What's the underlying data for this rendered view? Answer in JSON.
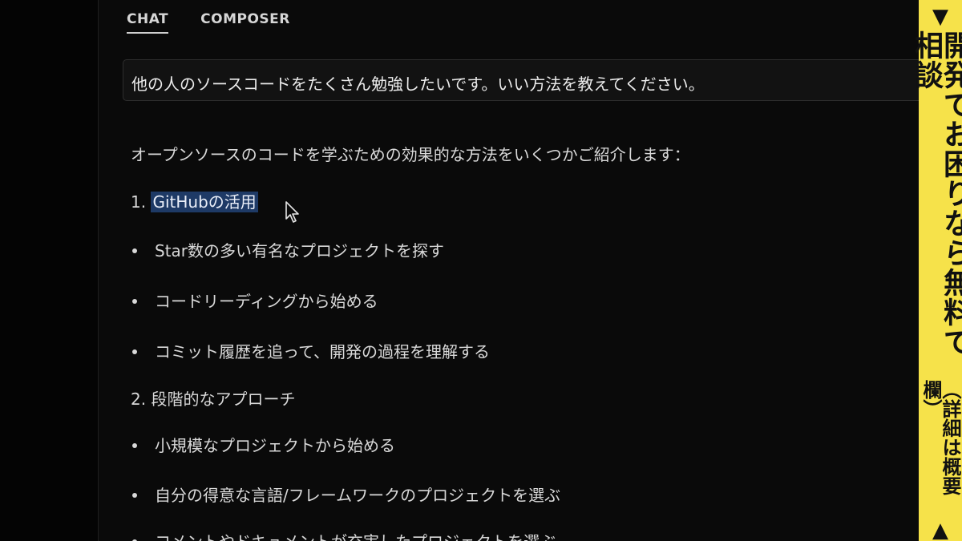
{
  "tabs": [
    {
      "label": "CHAT",
      "active": true
    },
    {
      "label": "COMPOSER",
      "active": false
    }
  ],
  "prompt": "他の人のソースコードをたくさん勉強したいです。いい方法を教えてください。",
  "response": {
    "intro": "オープンソースのコードを学ぶための効果的な方法をいくつかご紹介します：",
    "sections": [
      {
        "number": "1.",
        "title": "GitHubの活用",
        "items": [
          "Star数の多い有名なプロジェクトを探す",
          "コードリーディングから始める",
          "コミット履歴を追って、開発の過程を理解する"
        ]
      },
      {
        "number": "2.",
        "title": "段階的なアプローチ",
        "items": [
          "小規模なプロジェクトから始める",
          "自分の得意な言語/フレームワークのプロジェクトを選ぶ",
          "コメントやドキュメントが充実したプロジェクトを選ぶ"
        ]
      }
    ]
  },
  "banner": {
    "arrow_top": "▼",
    "main_text": "開発でお困りなら無料で相談",
    "sub_text": "（詳細は概要欄）",
    "arrow_bottom": "▲",
    "color": "#f6e24a"
  }
}
